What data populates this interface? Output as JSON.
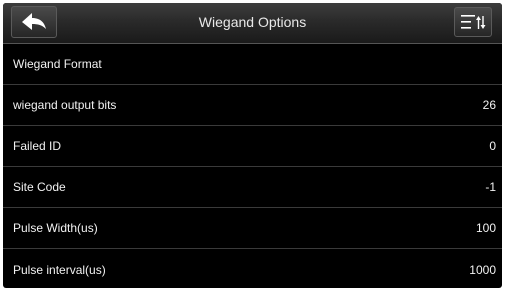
{
  "header": {
    "title": "Wiegand Options",
    "back_icon": "back-arrow-icon",
    "menu_icon": "sort-menu-icon"
  },
  "rows": [
    {
      "label": "Wiegand Format",
      "value": ""
    },
    {
      "label": "wiegand output bits",
      "value": "26"
    },
    {
      "label": "Failed ID",
      "value": "0"
    },
    {
      "label": "Site Code",
      "value": "-1"
    },
    {
      "label": "Pulse Width(us)",
      "value": "100"
    },
    {
      "label": "Pulse interval(us)",
      "value": "1000"
    }
  ]
}
